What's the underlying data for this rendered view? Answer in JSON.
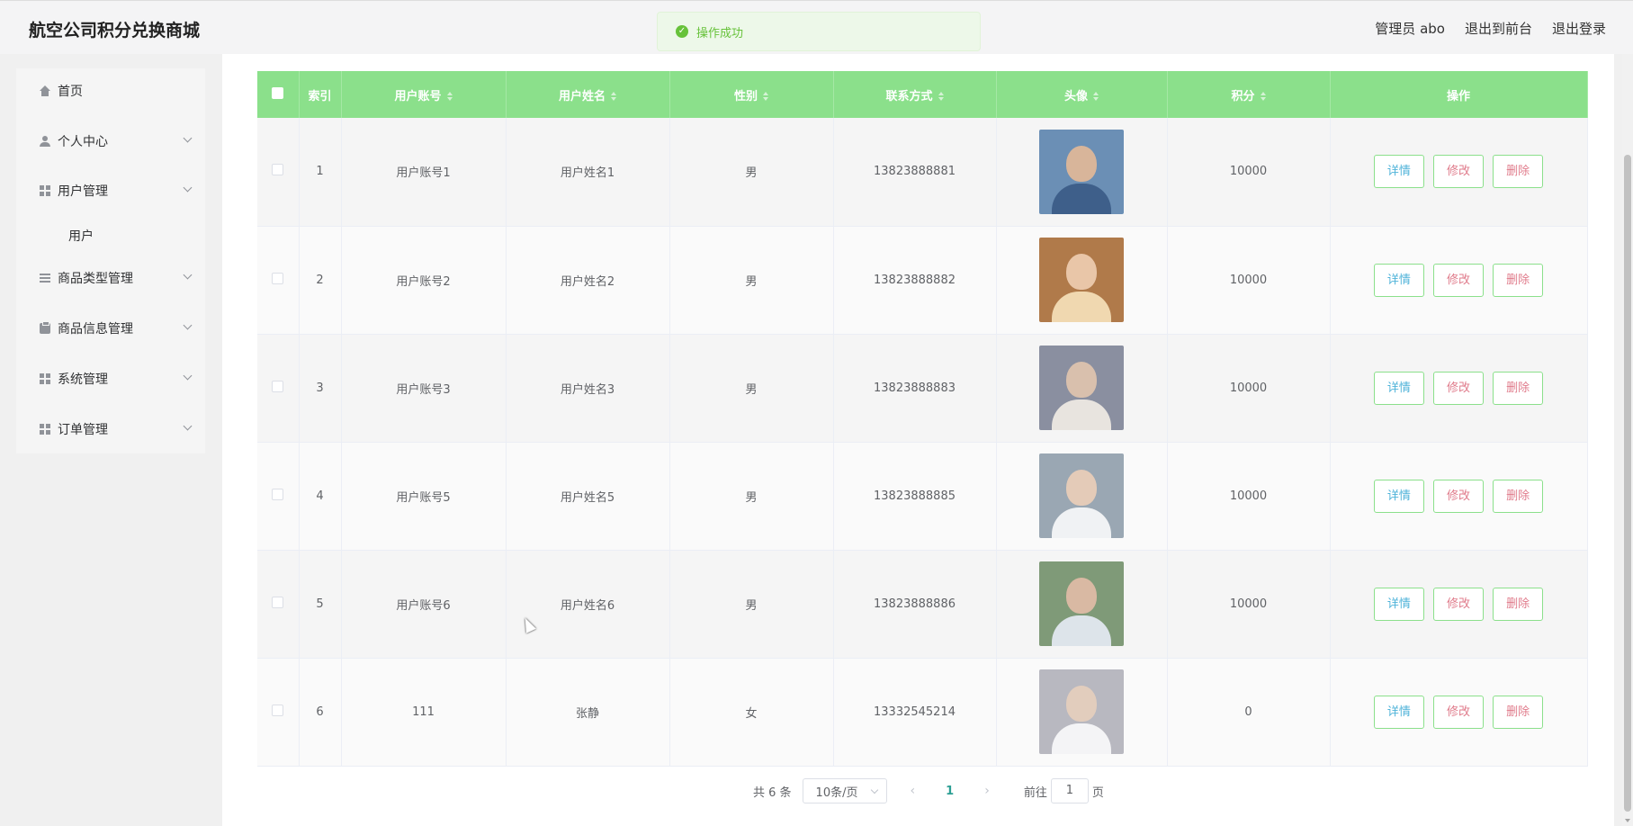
{
  "app": {
    "title": "航空公司积分兑换商城"
  },
  "top_links": {
    "admin": "管理员 abo",
    "to_front": "退出到前台",
    "logout": "退出登录"
  },
  "toast": {
    "message": "操作成功"
  },
  "sidebar": {
    "items": [
      {
        "label": "首页",
        "icon": "home-icon"
      },
      {
        "label": "个人中心",
        "icon": "user-icon"
      },
      {
        "label": "用户管理",
        "icon": "grid-icon"
      },
      {
        "label": "商品类型管理",
        "icon": "list-icon"
      },
      {
        "label": "商品信息管理",
        "icon": "clipboard-icon"
      },
      {
        "label": "系统管理",
        "icon": "grid-icon"
      },
      {
        "label": "订单管理",
        "icon": "grid-icon"
      }
    ],
    "sub_item": "用户"
  },
  "table": {
    "headers": [
      "索引",
      "用户账号",
      "用户姓名",
      "性别",
      "联系方式",
      "头像",
      "积分",
      "操作"
    ],
    "rows": [
      {
        "index": "1",
        "account": "用户账号1",
        "name": "用户姓名1",
        "gender": "男",
        "phone": "13823888881",
        "points": "10000"
      },
      {
        "index": "2",
        "account": "用户账号2",
        "name": "用户姓名2",
        "gender": "男",
        "phone": "13823888882",
        "points": "10000"
      },
      {
        "index": "3",
        "account": "用户账号3",
        "name": "用户姓名3",
        "gender": "男",
        "phone": "13823888883",
        "points": "10000"
      },
      {
        "index": "4",
        "account": "用户账号5",
        "name": "用户姓名5",
        "gender": "男",
        "phone": "13823888885",
        "points": "10000"
      },
      {
        "index": "5",
        "account": "用户账号6",
        "name": "用户姓名6",
        "gender": "男",
        "phone": "13823888886",
        "points": "10000"
      },
      {
        "index": "6",
        "account": "111",
        "name": "张静",
        "gender": "女",
        "phone": "13332545214",
        "points": "0"
      }
    ],
    "actions": {
      "detail": "详情",
      "edit": "修改",
      "delete": "删除"
    }
  },
  "pagination": {
    "total": "共 6 条",
    "page_size": "10条/页",
    "current": "1",
    "goto_prefix": "前往",
    "goto_value": "1",
    "goto_suffix": "页"
  },
  "colors": {
    "header_green": "#8be08b",
    "accent_teal": "#2c9f94"
  }
}
